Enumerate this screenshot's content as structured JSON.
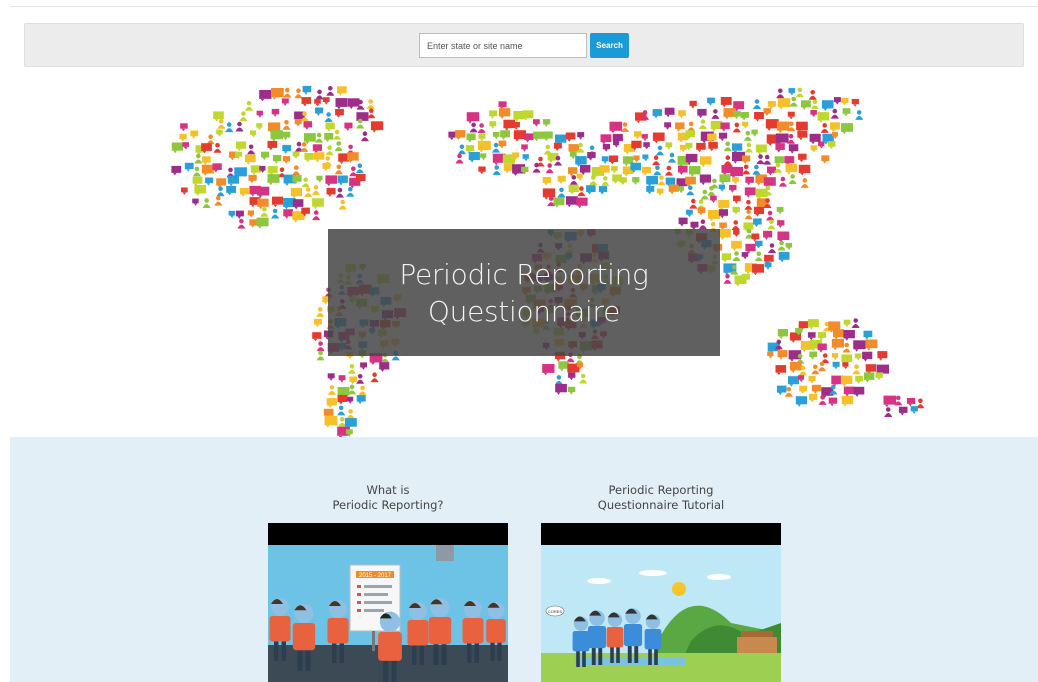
{
  "search": {
    "placeholder": "Enter state or site name",
    "button_label": "Search"
  },
  "hero": {
    "title": "Periodic Reporting\nQuestionnaire"
  },
  "videos": [
    {
      "title": "What is\nPeriodic Reporting?",
      "board_text": "2015 - 2017"
    },
    {
      "title": "Periodic Reporting\nQuestionnaire Tutorial",
      "bubble_text": "CORES"
    }
  ],
  "colors": {
    "search_button": "#1a9bd8",
    "lower_background": "#e3eff7",
    "hero_overlay": "#464646",
    "icon_palette": [
      "#e43a2f",
      "#f4c12b",
      "#8dc63f",
      "#9c2e8a",
      "#2a9fd8",
      "#f28c28",
      "#c0d730",
      "#d63384"
    ]
  }
}
